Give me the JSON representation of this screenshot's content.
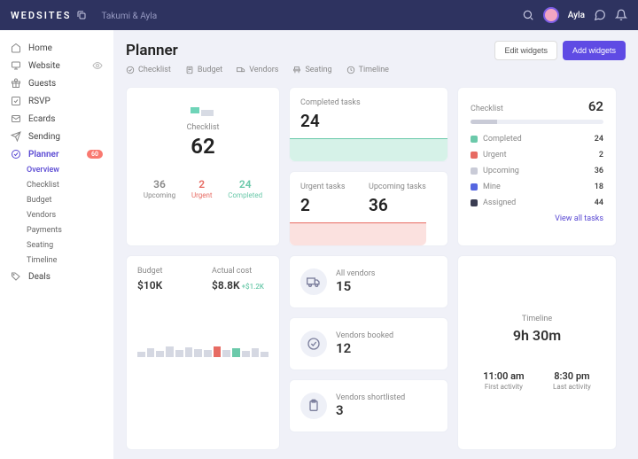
{
  "brand": "WEDSITES",
  "search": {
    "value": "Takumi & Ayla"
  },
  "user": {
    "name": "Ayla"
  },
  "nav": [
    {
      "label": "Home",
      "icon": "home"
    },
    {
      "label": "Website",
      "icon": "monitor",
      "eye": true
    },
    {
      "label": "Guests",
      "icon": "gift"
    },
    {
      "label": "RSVP",
      "icon": "check-square"
    },
    {
      "label": "Ecards",
      "icon": "mail"
    },
    {
      "label": "Sending",
      "icon": "send"
    },
    {
      "label": "Planner",
      "icon": "target",
      "active": true,
      "badge": "60"
    },
    {
      "label": "Deals",
      "icon": "tag"
    }
  ],
  "planner_sub": [
    {
      "label": "Overview",
      "active": true
    },
    {
      "label": "Checklist"
    },
    {
      "label": "Budget"
    },
    {
      "label": "Vendors"
    },
    {
      "label": "Payments"
    },
    {
      "label": "Seating"
    },
    {
      "label": "Timeline"
    }
  ],
  "page_title": "Planner",
  "actions": {
    "edit": "Edit widgets",
    "add": "Add widgets"
  },
  "tabs": [
    {
      "label": "Checklist",
      "icon": "target"
    },
    {
      "label": "Budget",
      "icon": "calc"
    },
    {
      "label": "Vendors",
      "icon": "truck"
    },
    {
      "label": "Seating",
      "icon": "chair"
    },
    {
      "label": "Timeline",
      "icon": "clock"
    }
  ],
  "checklist_card": {
    "label": "Checklist",
    "total": "62",
    "stats": [
      {
        "num": "36",
        "label": "Upcoming",
        "cls": "clr-upcoming"
      },
      {
        "num": "2",
        "label": "Urgent",
        "cls": "clr-urgent"
      },
      {
        "num": "24",
        "label": "Completed",
        "cls": "clr-completed"
      }
    ]
  },
  "completed_card": {
    "title": "Completed tasks",
    "value": "24"
  },
  "urgent_upcoming": {
    "urgent_label": "Urgent tasks",
    "urgent_val": "2",
    "upcoming_label": "Upcoming tasks",
    "upcoming_val": "36"
  },
  "checklist_list": {
    "title": "Checklist",
    "total": "62",
    "items": [
      {
        "label": "Completed",
        "value": "24",
        "color": "#6bc9aa"
      },
      {
        "label": "Urgent",
        "value": "2",
        "color": "#e76b63"
      },
      {
        "label": "Upcoming",
        "value": "36",
        "color": "#c9cbd7"
      },
      {
        "label": "Mine",
        "value": "18",
        "color": "#5566e0"
      },
      {
        "label": "Assigned",
        "value": "44",
        "color": "#3a3d52"
      }
    ],
    "view_all": "View all tasks"
  },
  "budget": {
    "budget_label": "Budget",
    "budget_val": "$10K",
    "actual_label": "Actual cost",
    "actual_val": "$8.8K",
    "delta": "+$1.2K"
  },
  "vendors": {
    "all_label": "All vendors",
    "all_val": "15",
    "booked_label": "Vendors booked",
    "booked_val": "12",
    "short_label": "Vendors shortlisted",
    "short_val": "3"
  },
  "timeline": {
    "title": "Timeline",
    "duration": "9h 30m",
    "first_time": "11:00 am",
    "first_label": "First activity",
    "last_time": "8:30 pm",
    "last_label": "Last activity"
  },
  "chart_data": [
    {
      "type": "pie",
      "title": "Checklist",
      "categories": [
        "Upcoming",
        "Urgent",
        "Completed"
      ],
      "values": [
        36,
        2,
        24
      ]
    },
    {
      "type": "bar",
      "title": "Checklist breakdown",
      "categories": [
        "Completed",
        "Urgent",
        "Upcoming",
        "Mine",
        "Assigned"
      ],
      "values": [
        24,
        2,
        36,
        18,
        44
      ]
    }
  ]
}
